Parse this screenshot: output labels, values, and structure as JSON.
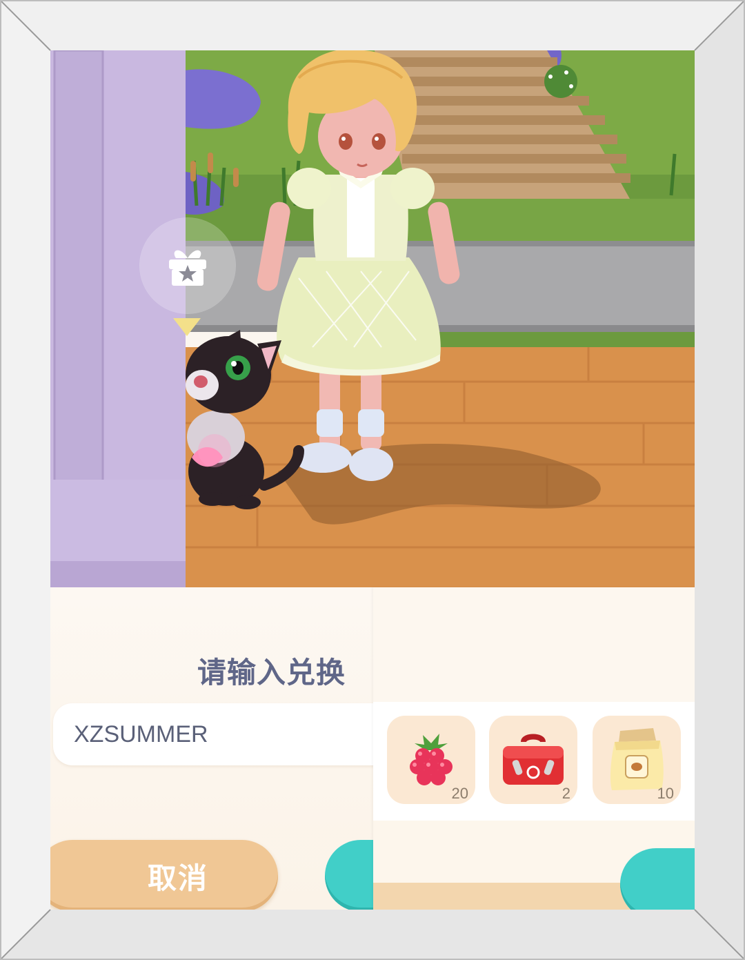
{
  "dialog": {
    "title": "请输入兑换",
    "code_value": "XZSUMMER",
    "cancel_label": "取消"
  },
  "rewards": [
    {
      "icon": "raspberry-icon",
      "count": "20"
    },
    {
      "icon": "toolbox-icon",
      "count": "2"
    },
    {
      "icon": "seed-bag-icon",
      "count": "10"
    }
  ],
  "scene": {
    "gift_icon": "gift-star-icon",
    "marker_icon": "triangle-marker-icon"
  },
  "colors": {
    "title_text": "#5f6688",
    "cancel_button": "#f0c795",
    "confirm_button": "#41cfc8",
    "reward_slot": "#fbe8d3"
  }
}
